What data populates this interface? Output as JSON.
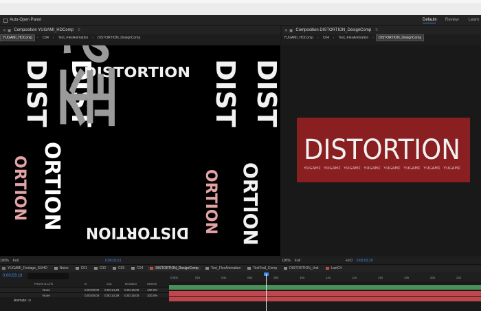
{
  "toolbar": {
    "auto_open": "Auto-Open Panel",
    "workspaces": [
      "Default",
      "Review",
      "Learn"
    ],
    "menu": "≡"
  },
  "left_panel": {
    "title": "Composition YUGAMI_HDComp",
    "menu": "≡",
    "crumbs": [
      "YUGAMI_HDComp",
      "C04",
      "Text_FlexAnimation",
      "DISTORTION_DesignComp"
    ],
    "footer": {
      "zoom": "100%",
      "resolution": "Full",
      "timecode": "0;00;02;21"
    }
  },
  "right_panel": {
    "title": "Composition DISTORTION_DesignComp",
    "menu": "≡",
    "crumbs": [
      "YUGAMI_HDComp",
      "C04",
      "Text_FlexAnimation",
      "DISTORTION_DesignComp"
    ],
    "footer": {
      "zoom": "100%",
      "resolution": "Full",
      "exposure": "+0.0",
      "timecode": "0;00;03;18"
    }
  },
  "art": {
    "distortion": "DISTORTION",
    "distort": "DISTORTION",
    "dist": "DIST",
    "ortion": "ORTION",
    "kanji": "歪み",
    "small_caps": "YUGAMI  YUGAMI  YUGAMI  YUGAMI  YUGAMI  YUGAMI  YUGAMI  YUGAMI"
  },
  "timeline": {
    "tabs": [
      {
        "label": "YUGAMI_Footage_SUHD",
        "color": "#7a7a7a"
      },
      {
        "label": "Noise",
        "color": "#888888"
      },
      {
        "label": "C01",
        "color": "#888888"
      },
      {
        "label": "C02",
        "color": "#888888"
      },
      {
        "label": "C03",
        "color": "#888888"
      },
      {
        "label": "C04",
        "color": "#888888"
      },
      {
        "label": "DISTORTION_DesignComp",
        "color": "#c24a4a"
      },
      {
        "label": "Text_FlexAnimation",
        "color": "#888888"
      },
      {
        "label": "TextTrail_Comp",
        "color": "#888888"
      },
      {
        "label": "DISTORTION_Unit",
        "color": "#888888"
      },
      {
        "label": "LastC4",
        "color": "#c24a4a"
      }
    ],
    "current_time": "0;00;03;18",
    "columns": [
      "Parent & Link",
      "In",
      "Out",
      "Duration",
      "Stretch"
    ],
    "layers": [
      {
        "parent": "None",
        "in": "0;00;00;00",
        "out": "0;00;14;29",
        "duration": "0;00;15;00",
        "stretch": "100.0%"
      },
      {
        "parent": "None",
        "in": "0;00;00;00",
        "out": "0;00;14;29",
        "duration": "0;00;15;00",
        "stretch": "100.0%"
      }
    ],
    "animate": "Animate: ⊙",
    "ruler": [
      "0;00s",
      "02s",
      "04s",
      "06s",
      "08s",
      "10s",
      "12s",
      "14s",
      "16s",
      "18s",
      "20s",
      "22s"
    ]
  },
  "colors": {
    "accent": "#3d8ef0",
    "brand_red": "#8a1f22",
    "bar_green": "#4a8f5a",
    "bar_red": "#c0464e"
  }
}
